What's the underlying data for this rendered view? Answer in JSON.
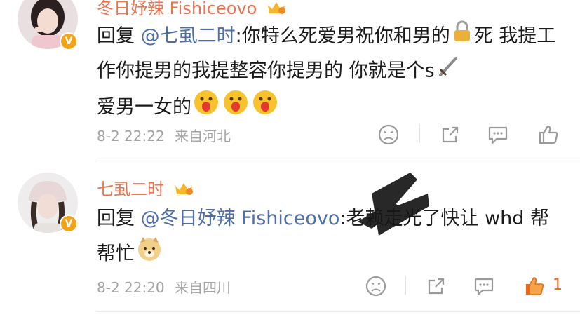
{
  "comments": [
    {
      "username": "冬日妤辣 Fishiceovo",
      "reply_prefix": "回复",
      "mention": "@七虱二时",
      "text_a": ":你特么死爱男祝你和男的",
      "text_b": "死 我提工作你提男的我提整容你提男的 你就是个s",
      "text_c": "爱男一女的",
      "date": "8-2 22:22",
      "location": "来自河北",
      "likes": ""
    },
    {
      "username": "七虱二时",
      "reply_prefix": "回复",
      "mention": "@冬日妤辣 Fishiceovo",
      "text_a": ":老赖走光了快让 whd 帮帮忙",
      "date": "8-2 22:20",
      "location": "来自四川",
      "likes": "1"
    }
  ],
  "icons": [
    "verified-badge-icon",
    "crown-badge-icon",
    "lock-emoji-icon",
    "dagger-emoji-icon",
    "tongue-emoji-icon",
    "doge-emoji-icon",
    "dislike-icon",
    "share-icon",
    "comment-icon",
    "like-icon"
  ],
  "colors": {
    "username": "#eb7350",
    "mention": "#4e6ea8",
    "meta": "#a3a3a3",
    "like_active": "#e86b1c",
    "badge": "#f3a318"
  }
}
